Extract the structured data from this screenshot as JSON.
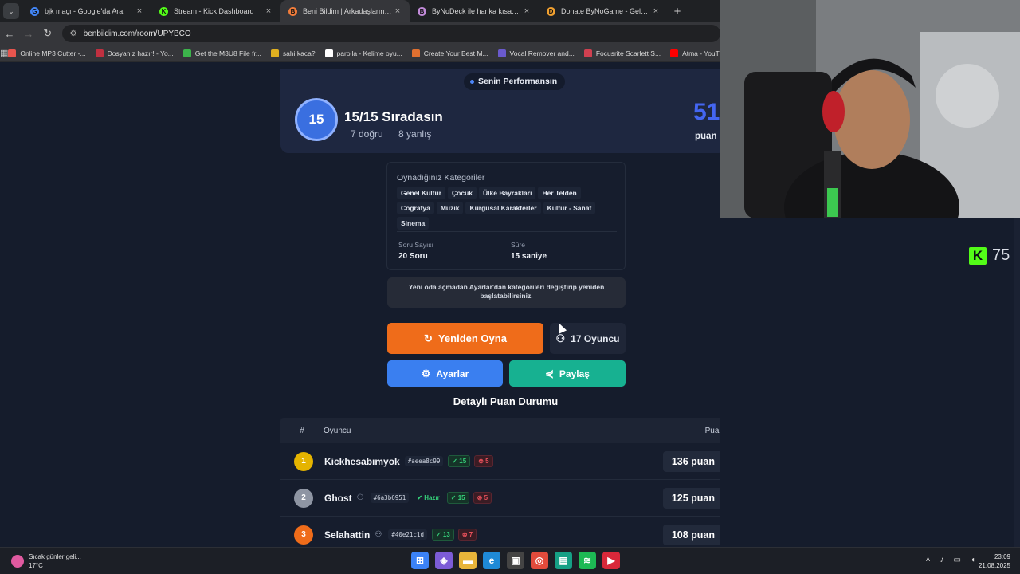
{
  "browser": {
    "tabs": [
      {
        "title": "bjk maçı - Google'da Ara",
        "fav_color": "#4285f4",
        "fav_glyph": "G"
      },
      {
        "title": "Stream - Kick Dashboard",
        "fav_color": "#53fc18",
        "fav_glyph": "K"
      },
      {
        "title": "Beni Bildim | Arkadaşlarınla Onli",
        "fav_color": "#f07c3b",
        "fav_glyph": "B",
        "active": true
      },
      {
        "title": "ByNoDeck ile harika kısayollar y",
        "fav_color": "#c08ad8",
        "fav_glyph": "B"
      },
      {
        "title": "Donate ByNoGame - Gelen/Gid",
        "fav_color": "#f0a030",
        "fav_glyph": "D"
      }
    ],
    "url": "benbildim.com/room/UPYBCO",
    "bookmarks": [
      {
        "label": "Online MP3 Cutter -...",
        "color": "#e8554e"
      },
      {
        "label": "Dosyanız hazır! - Yo...",
        "color": "#c03040"
      },
      {
        "label": "Get the M3U8 File fr...",
        "color": "#3cb44b"
      },
      {
        "label": "sahi kaca?",
        "color": "#e0b020"
      },
      {
        "label": "parolla - Kelime oyu...",
        "color": "#ffffff"
      },
      {
        "label": "Create Your Best M...",
        "color": "#e07030"
      },
      {
        "label": "Vocal Remover and...",
        "color": "#6a5acd"
      },
      {
        "label": "Focusrite Scarlett S...",
        "color": "#d04050"
      },
      {
        "label": "Atma - YouTube",
        "color": "#ff0000"
      }
    ]
  },
  "performance": {
    "tag": "Senin Performansın",
    "rank": "15",
    "title": "15/15 Sıradasın",
    "correct": "7 doğru",
    "wrong": "8 yanlış",
    "score": "51",
    "score_unit": "puan"
  },
  "categories": {
    "title": "Oynadığınız Kategoriler",
    "items": [
      "Genel Kültür",
      "Çocuk",
      "Ülke Bayrakları",
      "Her Telden",
      "Coğrafya",
      "Müzik",
      "Kurgusal Karakterler",
      "Kültür - Sanat",
      "Sinema"
    ],
    "question_count_label": "Soru Sayısı",
    "question_count": "20 Soru",
    "duration_label": "Süre",
    "duration": "15 saniye"
  },
  "note": "Yeni oda açmadan Ayarlar'dan kategorileri değiştirip yeniden başlatabilirsiniz.",
  "buttons": {
    "replay": "Yeniden Oyna",
    "players": "17 Oyuncu",
    "settings": "Ayarlar",
    "share": "Paylaş"
  },
  "leaderboard": {
    "title": "Detaylı Puan Durumu",
    "headers": {
      "num": "#",
      "player": "Oyuncu",
      "points": "Puan"
    },
    "rows": [
      {
        "rank": "1",
        "medal": "#e5b400",
        "name": "Kickhesabımyok",
        "hash": "#aeea8c99",
        "ready": "",
        "ok": "15",
        "bad": "5",
        "points": "136 puan"
      },
      {
        "rank": "2",
        "medal": "#8e95a3",
        "name": "Ghost",
        "hash": "#6a3b6951",
        "ready": "Hazır",
        "ok": "15",
        "bad": "5",
        "points": "125 puan"
      },
      {
        "rank": "3",
        "medal": "#ef6c1a",
        "name": "Selahattin",
        "hash": "#40e21c1d",
        "ready": "",
        "ok": "13",
        "bad": "7",
        "points": "108 puan"
      }
    ]
  },
  "overlay": {
    "kick_count": "75"
  },
  "taskbar": {
    "weather_title": "Sıcak günler geli...",
    "weather_temp": "17°C",
    "time": "23:09",
    "date": "21.08.2025"
  }
}
